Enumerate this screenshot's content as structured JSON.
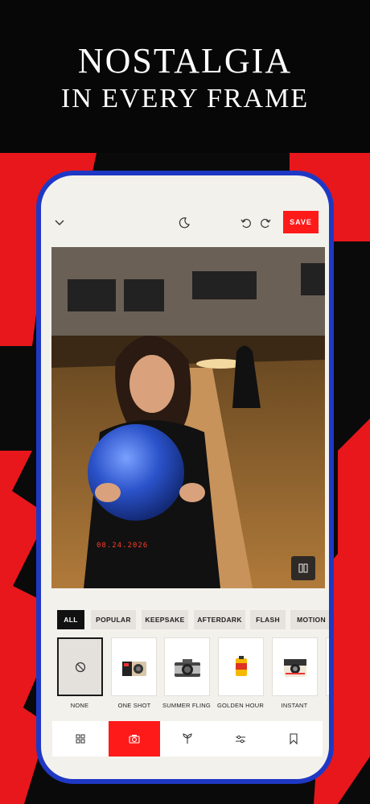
{
  "headline": {
    "line1": "NOSTALGIA",
    "line2": "IN EVERY FRAME"
  },
  "toolbar": {
    "collapse_icon": "chevron-down-icon",
    "theme_icon": "moon-icon",
    "undo_icon": "undo-icon",
    "redo_icon": "redo-icon",
    "save_label": "SAVE"
  },
  "photo": {
    "date_stamp": "08.24.2026",
    "compare_icon": "compare-icon"
  },
  "filter_tabs": [
    "ALL",
    "POPULAR",
    "KEEPSAKE",
    "AFTERDARK",
    "FLASH",
    "MOTION"
  ],
  "active_tab": "ALL",
  "presets": [
    {
      "label": "NONE",
      "icon": "none-icon",
      "selected": true
    },
    {
      "label": "ONE SHOT",
      "icon": "disposable-camera-icon"
    },
    {
      "label": "SUMMER FLING",
      "icon": "retro-camera-icon"
    },
    {
      "label": "GOLDEN HOUR",
      "icon": "film-roll-icon"
    },
    {
      "label": "INSTANT",
      "icon": "instant-camera-icon"
    }
  ],
  "bottom_nav": [
    {
      "name": "grid",
      "icon": "grid-icon"
    },
    {
      "name": "camera",
      "icon": "camera-icon",
      "active": true
    },
    {
      "name": "effects",
      "icon": "leaf-icon"
    },
    {
      "name": "adjust",
      "icon": "sliders-icon"
    },
    {
      "name": "saved",
      "icon": "bookmark-icon"
    }
  ],
  "colors": {
    "accent": "#ff1a1a",
    "phone_frame": "#1f38c4",
    "screen": "#f3f1ec",
    "background": "#070707"
  }
}
